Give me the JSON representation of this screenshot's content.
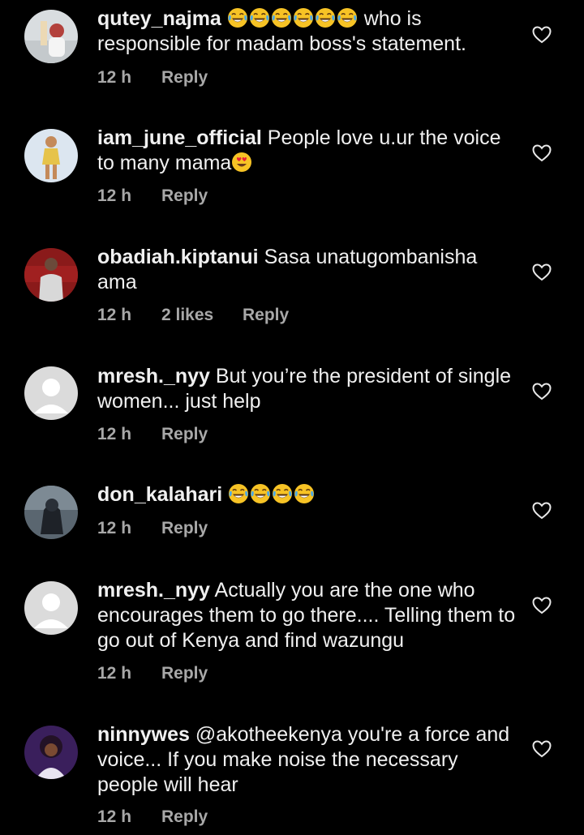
{
  "comments": [
    {
      "username": "qutey_najma",
      "emoji": [
        "laughing-tears",
        "laughing-tears",
        "laughing-tears",
        "laughing-tears",
        "laughing-tears",
        "laughing-tears"
      ],
      "text": " who is responsible for madam boss's statement.",
      "time": "12 h",
      "likes": "",
      "reply": "Reply",
      "avatar": "photo"
    },
    {
      "username": "iam_june_official",
      "text": " People love u.ur the voice to many mama",
      "trailing_emoji": "heart-eyes",
      "time": "12 h",
      "likes": "",
      "reply": "Reply",
      "avatar": "photo"
    },
    {
      "username": "obadiah.kiptanui",
      "text": " Sasa unatugombanisha ama",
      "time": "12 h",
      "likes": "2 likes",
      "reply": "Reply",
      "avatar": "photo"
    },
    {
      "username": "mresh._nyy",
      "text": " But you’re the president of single women... just help",
      "time": "12 h",
      "likes": "",
      "reply": "Reply",
      "avatar": "default"
    },
    {
      "username": "don_kalahari",
      "emoji_after_name": [
        "laughing-tears",
        "laughing-tears",
        "laughing-tears",
        "laughing-tears"
      ],
      "text": "",
      "time": "12 h",
      "likes": "",
      "reply": "Reply",
      "avatar": "photo"
    },
    {
      "username": "mresh._nyy",
      "text": " Actually you are the one who encourages them to go there.... Telling them to go out of Kenya and find wazungu",
      "time": "12 h",
      "likes": "",
      "reply": "Reply",
      "avatar": "default"
    },
    {
      "username": "ninnywes",
      "text": " @akotheekenya you're a force and voice... If you make noise the necessary people will hear",
      "time": "12 h",
      "likes": "",
      "reply": "Reply",
      "avatar": "photo"
    }
  ],
  "colors": {
    "background": "#000000",
    "text": "#f0f0f0",
    "meta": "#a8a8a8"
  }
}
